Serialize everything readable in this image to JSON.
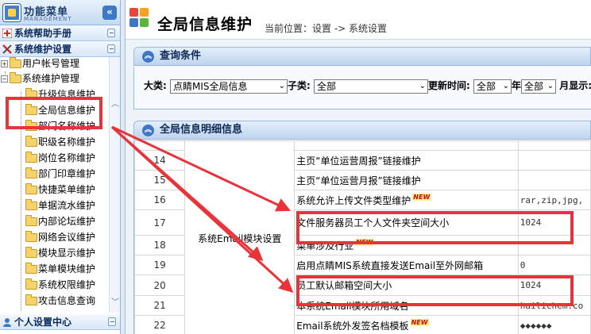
{
  "sidebar": {
    "title": "功能菜单",
    "subtitle": "MANAGEMENT",
    "collapse_icon": "«",
    "sections": {
      "help": "系统帮助手册",
      "maintenance": "系统维护设置",
      "personal": "个人设置中心"
    },
    "tree": {
      "user_account": "用户帐号管理",
      "system_maintenance": "系统维护管理",
      "items": [
        "升级信息维护",
        "全局信息维护",
        "部门名称维护",
        "职级名称维护",
        "岗位名称维护",
        "部门印章维护",
        "快捷菜单维护",
        "单据流水维护",
        "内部论坛维护",
        "网络会议维护",
        "模块显示维护",
        "菜单模块维护",
        "系统权限维护",
        "攻击信息查询"
      ]
    }
  },
  "header": {
    "title": "全局信息维护",
    "breadcrumb": "当前位置：设置 -> 系统设置"
  },
  "query": {
    "panel_title": "查询条件",
    "category_label": "大类:",
    "category_value": "点睛MIS全局信息",
    "subcategory_label": "子类:",
    "subcategory_value": "全部",
    "update_time_label": "更新时间:",
    "year_value": "全部",
    "year_suffix": "年",
    "month_value": "全部",
    "month_display_label": "月显示:"
  },
  "grid": {
    "panel_title": "全局信息明细信息",
    "group_label": "系统Email模块设置",
    "new_badge": "NEW",
    "rows": [
      {
        "num": "",
        "name": "",
        "value": ""
      },
      {
        "num": "14",
        "name": "主页“单位运营周报”链接维护",
        "value": "",
        "new": false
      },
      {
        "num": "15",
        "name": "主页“单位运营月报”链接维护",
        "value": "",
        "new": false
      },
      {
        "num": "16",
        "name": "系统允许上传文件类型维护",
        "value": "rar,zip,jpg,",
        "new": true
      },
      {
        "num": "17",
        "name": "文件服务器员工个人文件夹空间大小",
        "value": "1024",
        "new": false
      },
      {
        "num": "18",
        "name": "菜单涉及行业",
        "value": "",
        "new": true
      },
      {
        "num": "19",
        "name": "启用点睛MIS系统直接发送Email至外网邮箱",
        "value": "0",
        "new": false
      },
      {
        "num": "20",
        "name": "员工默认邮箱空间大小",
        "value": "1024",
        "new": false
      },
      {
        "num": "21",
        "name": "本系统Email模块所用域名",
        "value": "hailichem.co",
        "new": false
      },
      {
        "num": "22",
        "name": "Email系统外发签名档模板",
        "value": "◆◆◆◆◆◆",
        "new": true
      }
    ]
  },
  "colors": {
    "highlight": "#e8333a",
    "accent": "#3d78c6"
  }
}
